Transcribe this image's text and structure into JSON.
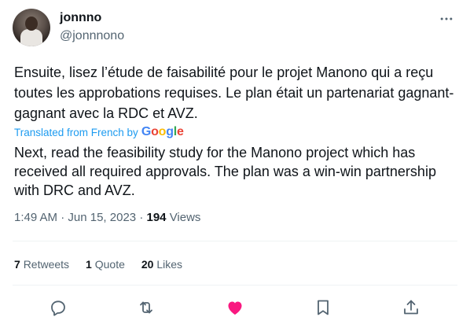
{
  "author": {
    "display_name": "jonnno",
    "handle": "@jonnnono"
  },
  "tweet": {
    "text": "Ensuite, lisez l’étude de faisabilité pour le projet Manono qui a reçu toutes les approbations requises. Le plan était un partenariat gagnant-gagnant avec la RDC et AVZ.",
    "translated_label": "Translated from French by",
    "translation_provider": "Google",
    "translation": "Next, read the feasibility study for the Manono project which has received all required approvals. The plan was a win-win partnership with DRC and AVZ."
  },
  "meta": {
    "time": "1:49 AM",
    "separator1": "·",
    "date": "Jun 15, 2023",
    "separator2": "·",
    "views_count": "194",
    "views_label": "Views"
  },
  "stats": {
    "retweets_count": "7",
    "retweets_label": "Retweets",
    "quotes_count": "1",
    "quotes_label": "Quote",
    "likes_count": "20",
    "likes_label": "Likes"
  },
  "icons": {
    "more": "more-horizontal-icon",
    "reply": "reply-icon",
    "retweet": "retweet-icon",
    "like": "heart-icon",
    "bookmark": "bookmark-icon",
    "share": "share-icon"
  },
  "colors": {
    "link": "#1d9bf0",
    "like_active": "#f91880",
    "secondary_text": "#536471",
    "primary_text": "#0f1419",
    "divider": "#eff3f4"
  }
}
